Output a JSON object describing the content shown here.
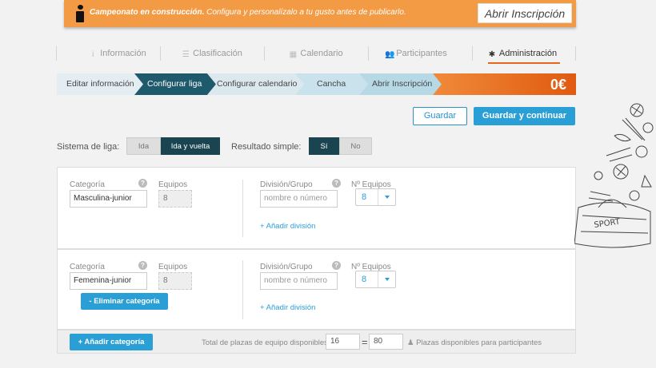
{
  "banner": {
    "title_bold": "Campeonato en construcción.",
    "title_rest": " Configura y personalízalo a tu gusto antes de publicarlo.",
    "open_button": "Abrir Inscripción",
    "bg_color": "#f39a45"
  },
  "tabs": [
    {
      "label": "Información",
      "icon": "info-icon"
    },
    {
      "label": "Clasificación",
      "icon": "list-icon"
    },
    {
      "label": "Calendario",
      "icon": "calendar-icon"
    },
    {
      "label": "Participantes",
      "icon": "users-icon"
    },
    {
      "label": "Administración",
      "icon": "gear-icon",
      "active": true
    }
  ],
  "stepper": {
    "steps": [
      "Editar información",
      "Configurar liga",
      "Configurar calendario",
      "Cancha",
      "Abrir Inscripción"
    ],
    "active_index": 1,
    "price": "0€",
    "accent_color": "#e8651a"
  },
  "actions": {
    "save": "Guardar",
    "save_continue": "Guardar y continuar"
  },
  "league": {
    "system_label": "Sistema de liga:",
    "system_options": [
      "Ida",
      "Ida y vuelta"
    ],
    "system_selected": "Ida y vuelta",
    "result_label": "Resultado simple:",
    "result_options": [
      "Sí",
      "No"
    ],
    "result_selected": "Sí"
  },
  "categories": [
    {
      "category_label": "Categoría",
      "category_value": "Masculina-junior",
      "teams_label": "Equipos",
      "teams_value": "8",
      "division_label": "División/Grupo",
      "division_placeholder": "nombre o número",
      "n_teams_label": "Nº Equipos",
      "n_teams_value": "8",
      "add_division": "+ Añadir división"
    },
    {
      "category_label": "Categoría",
      "category_value": "Femenina-junior",
      "teams_label": "Equipos",
      "teams_value": "8",
      "division_label": "División/Grupo",
      "division_placeholder": "nombre o número",
      "n_teams_label": "Nº Equipos",
      "n_teams_value": "8",
      "add_division": "+ Añadir división",
      "remove_category": "- Eliminar categoría"
    }
  ],
  "help_mark": "?",
  "footer": {
    "add_category": "+ Añadir categoría",
    "total_label": "Total de plazas de equipo disponibles:",
    "total_value": "16",
    "equals": "=",
    "participants_value": "80",
    "participants_label": "Plazas disponibles para participantes"
  }
}
